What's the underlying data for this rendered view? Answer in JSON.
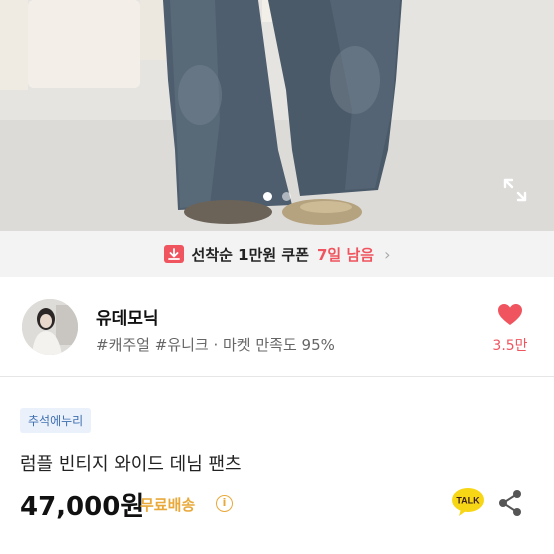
{
  "gallery": {
    "total_images": 2,
    "current_index": 1
  },
  "coupon": {
    "text": "선착순 1만원 쿠폰",
    "days_left": "7일 남음"
  },
  "seller": {
    "name": "유데모닉",
    "tags": "#캐주얼 #유니크 · 마켓 만족도 95%",
    "like_count": "3.5만"
  },
  "product": {
    "badge": "추석에누리",
    "title": "럼플 빈티지 와이드 데님 팬츠",
    "price": "47,000원",
    "shipping": "무료배송"
  },
  "icons": {
    "expand": "expand-icon",
    "coupon": "coupon-download-icon",
    "heart": "heart-icon",
    "talk": "kakao-talk-icon",
    "share": "share-icon",
    "info": "info-icon"
  },
  "colors": {
    "accent_red": "#f0555f",
    "shipping_yellow": "#e8a93a",
    "badge_blue": "#3f6fb0",
    "talk_yellow": "#f7d616"
  }
}
